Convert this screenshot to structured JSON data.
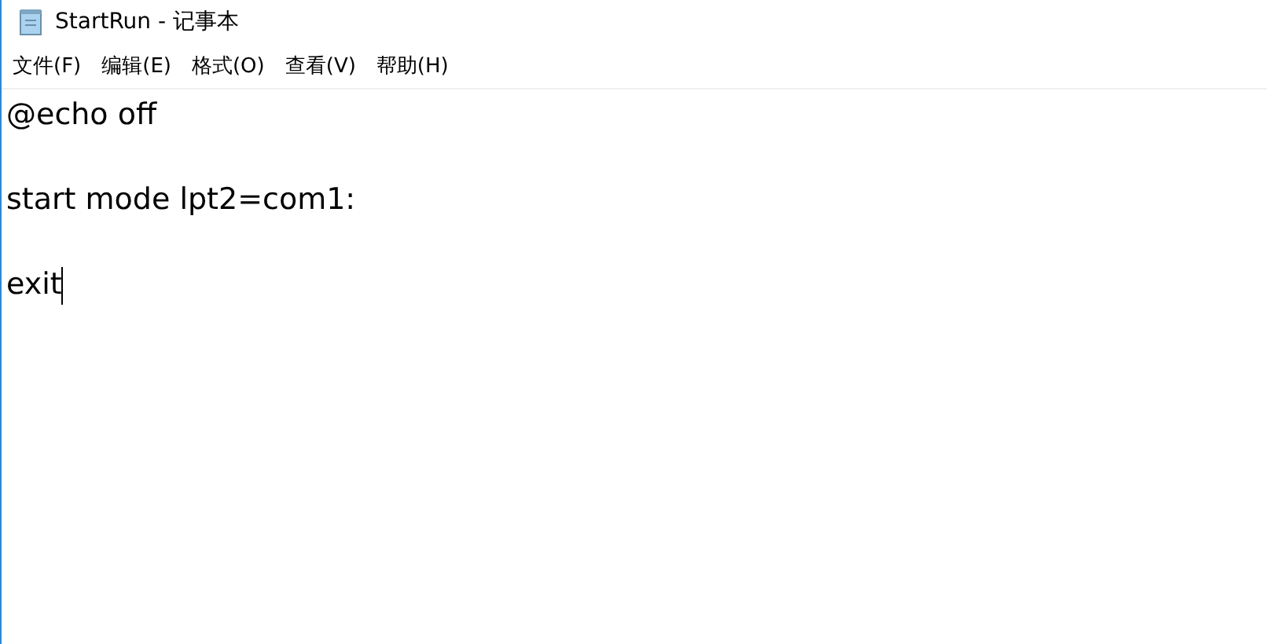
{
  "window": {
    "title": "StartRun  - 记事本"
  },
  "menu": [
    "文件(F)",
    "编辑(E)",
    "格式(O)",
    "查看(V)",
    "帮助(H)"
  ],
  "editor": {
    "lines": [
      "@echo off",
      "start mode lpt2=com1:",
      "exit"
    ]
  }
}
